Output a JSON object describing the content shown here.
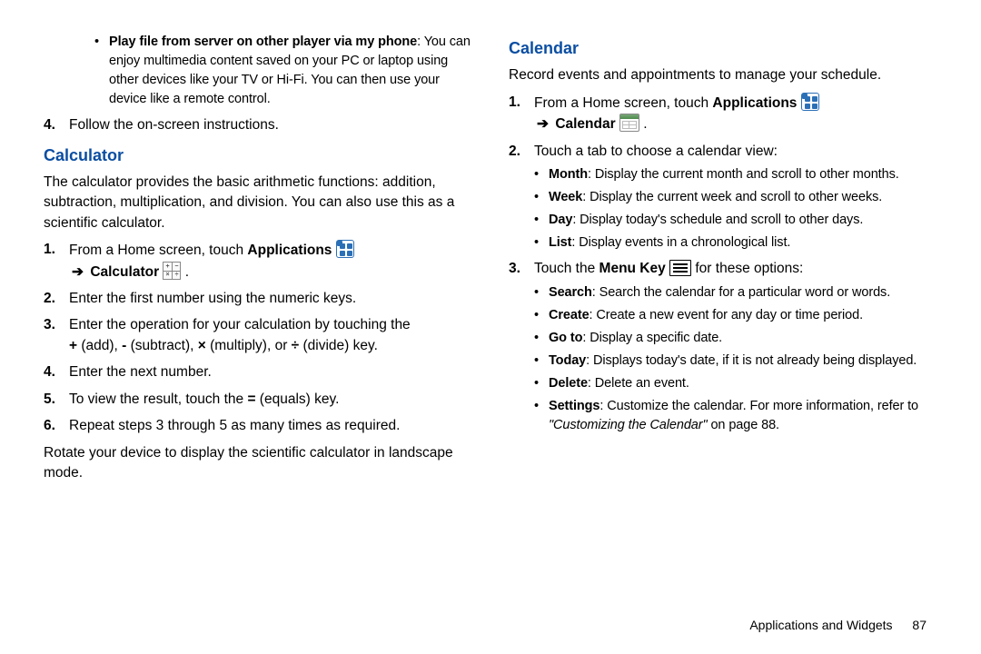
{
  "left": {
    "topBulletLabel": "Play file from server on other player via my phone",
    "topBulletText": ": You can enjoy multimedia content saved on your PC or laptop using other devices like your TV or Hi-Fi. You can then use your device like a remote control.",
    "step4": "Follow the on-screen instructions.",
    "calcHeading": "Calculator",
    "calcIntro": "The calculator provides the basic arithmetic functions: addition, subtraction, multiplication, and division. You can also use this as a scientific calculator.",
    "step1a": "From a Home screen, touch ",
    "applications": "Applications",
    "step1b": "Calculator",
    "step2": "Enter the first number using the numeric keys.",
    "step3": "Enter the operation for your calculation by touching the ",
    "step3ops": "+ (add), - (subtract), × (multiply), or ÷ (divide) key.",
    "step4b": "Enter the next number.",
    "step5a": "To view the result, touch the ",
    "equals": "=",
    "step5b": " (equals) key.",
    "step6": "Repeat steps 3 through 5 as many times as required.",
    "rotate": "Rotate your device to display the scientific calculator in landscape mode."
  },
  "right": {
    "calHeading": "Calendar",
    "calIntro": "Record events and appointments to manage your schedule.",
    "step1a": "From a Home screen, touch ",
    "step1b": "Calendar",
    "step2": "Touch a tab to choose a calendar view:",
    "views": [
      {
        "label": "Month",
        "text": ": Display the current month and scroll to other months."
      },
      {
        "label": "Week",
        "text": ": Display the current week and scroll to other weeks."
      },
      {
        "label": "Day",
        "text": ": Display today's schedule and scroll to other days."
      },
      {
        "label": "List",
        "text": ": Display events in a chronological list."
      }
    ],
    "step3a": "Touch the ",
    "menuKey": "Menu Key",
    "step3b": " for these options:",
    "options": [
      {
        "label": "Search",
        "text": ": Search the calendar for a particular word or words."
      },
      {
        "label": "Create",
        "text": ": Create a new event for any day or time period."
      },
      {
        "label": "Go to",
        "text": ": Display a specific date."
      },
      {
        "label": "Today",
        "text": ": Displays today's date, if it is not already being displayed."
      },
      {
        "label": "Delete",
        "text": ": Delete an event."
      },
      {
        "label": "Settings",
        "text": ": Customize the calendar. For more information, refer to "
      }
    ],
    "settingsRef": "\"Customizing the Calendar\"",
    "settingsPage": " on page 88."
  },
  "footer": {
    "section": "Applications and Widgets",
    "page": "87"
  },
  "num": {
    "n1": "1.",
    "n2": "2.",
    "n3": "3.",
    "n4": "4.",
    "n5": "5.",
    "n6": "6."
  },
  "arrow": "➔"
}
